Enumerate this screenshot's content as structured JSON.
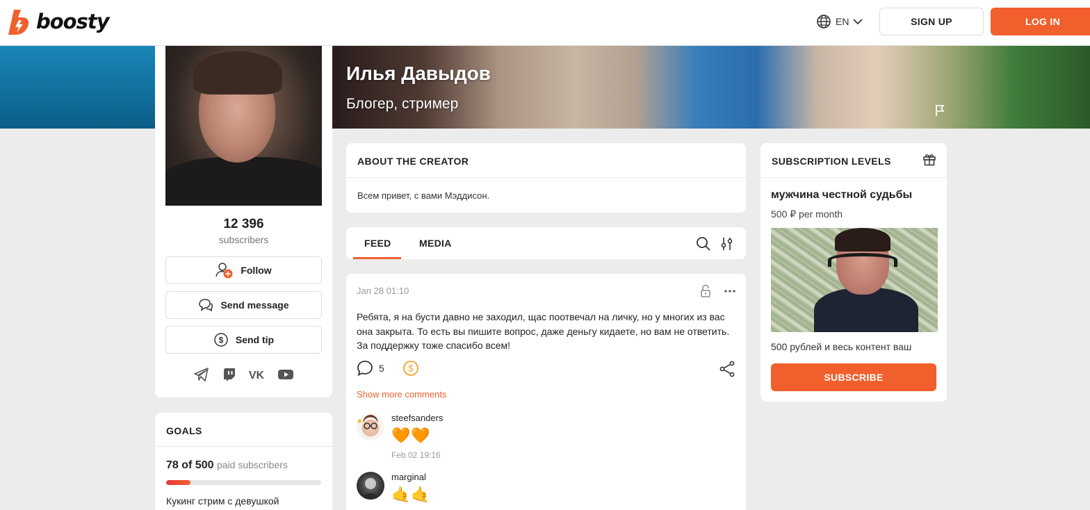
{
  "header": {
    "logo_text": "boosty",
    "language": "EN",
    "signup_label": "SIGN UP",
    "login_label": "LOG IN"
  },
  "creator": {
    "name": "Илья Давыдов",
    "subtitle": "Блогер, стример",
    "subscribers_count": "12 396",
    "subscribers_label": "subscribers"
  },
  "profile_actions": {
    "follow": "Follow",
    "message": "Send message",
    "tip": "Send tip"
  },
  "socials": [
    "telegram-icon",
    "twitch-icon",
    "vk-icon",
    "youtube-icon"
  ],
  "goals": {
    "title": "GOALS",
    "current": "78",
    "of_label": "of",
    "target": "500",
    "unit": "paid subscribers",
    "progress": 0.156,
    "description": "Кукинг стрим с девушкой"
  },
  "about": {
    "title": "ABOUT THE CREATOR",
    "text": "Всем привет, с вами Мэддисон."
  },
  "tabs": [
    {
      "label": "FEED",
      "active": true
    },
    {
      "label": "MEDIA",
      "active": false
    }
  ],
  "post": {
    "date": "Jan 28 01:10",
    "text": "Ребята, я на бусти давно не заходил, щас поотвечал на личку, но у многих из вас она закрыта. То есть вы пишите вопрос, даже деньгу кидаете, но вам не ответить. За поддержку тоже спасибо всем!",
    "comment_count": "5",
    "show_more": "Show more comments",
    "comments": [
      {
        "author": "steefsanders",
        "emoji": "🧡🧡",
        "date": "Feb 02 19:16"
      },
      {
        "author": "marginal",
        "emoji": "🤙🤙",
        "date": ""
      }
    ]
  },
  "levels": {
    "title": "SUBSCRIPTION LEVELS",
    "name": "мужчина честной судьбы",
    "price": "500 ₽ per month",
    "description": "500 рублей и весь контент ваш",
    "subscribe_label": "SUBSCRIBE"
  },
  "colors": {
    "accent": "#f15f2c",
    "background": "#ececec",
    "card": "#ffffff"
  }
}
